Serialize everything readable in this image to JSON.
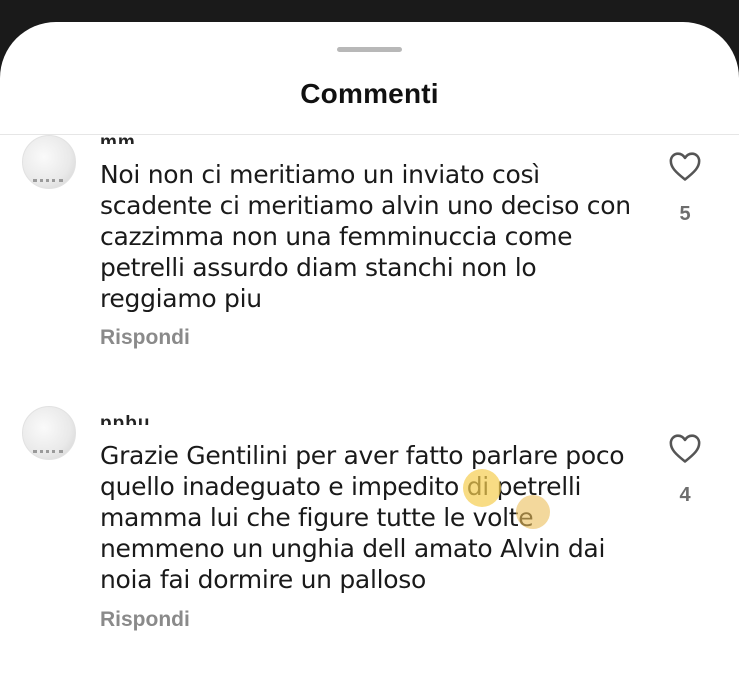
{
  "sheet": {
    "title": "Commenti"
  },
  "comments": [
    {
      "username": "mm",
      "text": "Noi non ci meritiamo un inviato così\nscadente ci meritiamo alvin uno deciso con\ncazzimma non una femminuccia come\npetrelli assurdo diam stanchi non lo\nreggiamo piu",
      "likes": "5",
      "reply_label": "Rispondi",
      "like_icon": "heart-outline-icon"
    },
    {
      "username": "ppbu",
      "text": "Grazie Gentilini per aver fatto parlare poco\nquello inadeguato e impedito di petrelli\nmamma lui che figure tutte le volte\nnemmeno un unghia dell amato Alvin dai\nnoia fai dormire un palloso",
      "likes": "4",
      "reply_label": "Rispondi",
      "like_icon": "heart-outline-icon"
    }
  ],
  "colors": {
    "background": "#1a1a1a",
    "sheet": "#ffffff",
    "text": "#1a1a1a",
    "muted": "#8a8a8a",
    "heart": "#555555"
  }
}
